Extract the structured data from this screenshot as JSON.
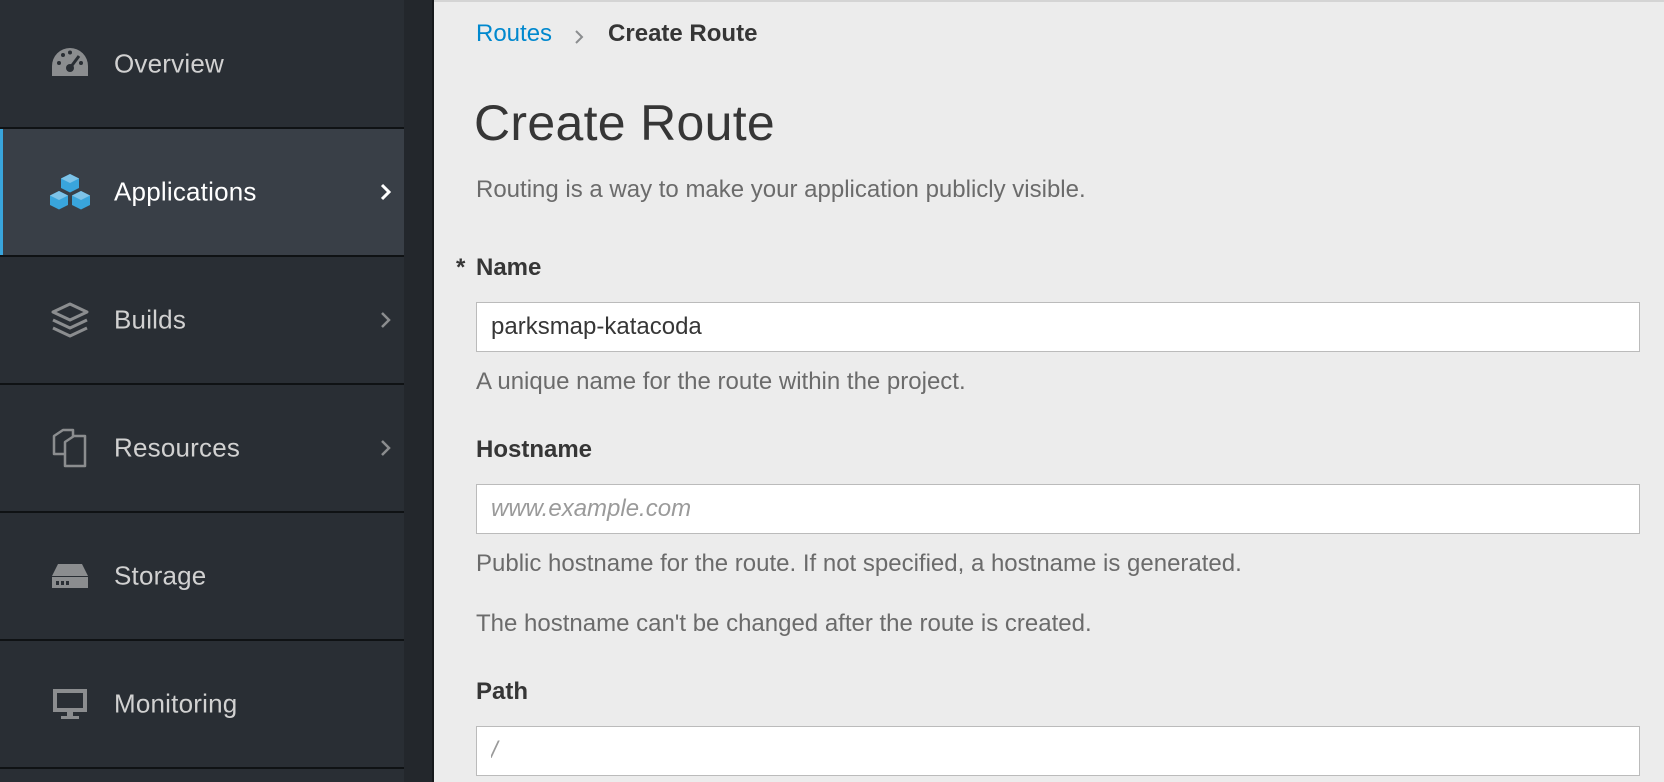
{
  "sidebar": {
    "items": [
      {
        "label": "Overview",
        "icon": "dashboard-icon",
        "has_chevron": false,
        "active": false
      },
      {
        "label": "Applications",
        "icon": "cubes-icon",
        "has_chevron": true,
        "active": true
      },
      {
        "label": "Builds",
        "icon": "layers-icon",
        "has_chevron": true,
        "active": false
      },
      {
        "label": "Resources",
        "icon": "copy-files-icon",
        "has_chevron": true,
        "active": false
      },
      {
        "label": "Storage",
        "icon": "hdd-icon",
        "has_chevron": false,
        "active": false
      },
      {
        "label": "Monitoring",
        "icon": "desktop-icon",
        "has_chevron": false,
        "active": false
      }
    ]
  },
  "breadcrumb": {
    "parent": "Routes",
    "current": "Create Route"
  },
  "page": {
    "title": "Create Route",
    "subtitle": "Routing is a way to make your application publicly visible."
  },
  "form": {
    "name": {
      "required_marker": "*",
      "label": "Name",
      "value": "parksmap-katacoda",
      "help": "A unique name for the route within the project."
    },
    "hostname": {
      "label": "Hostname",
      "value": "",
      "placeholder": "www.example.com",
      "help": "Public hostname for the route. If not specified, a hostname is generated.",
      "note": "The hostname can't be changed after the route is created."
    },
    "path": {
      "label": "Path",
      "value": "",
      "placeholder": "/"
    }
  },
  "colors": {
    "sidebar_bg": "#292e34",
    "sidebar_active_bg": "#393f47",
    "accent": "#39a5dc",
    "link": "#0088ce",
    "content_bg": "#ececec"
  }
}
